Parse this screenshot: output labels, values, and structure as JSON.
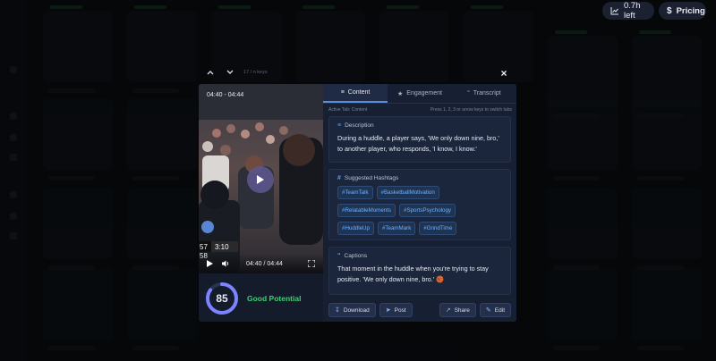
{
  "top_bar": {
    "credits_label": "0.7h left",
    "pricing_label": "Pricing"
  },
  "modal": {
    "nav_counter": "17 / n keys",
    "close_label": "×",
    "video": {
      "timestamp_top": "04:40 - 04:44",
      "time_display": "04:40 / 04:44",
      "scoreboard": [
        "57",
        "3:10",
        "58"
      ]
    },
    "score": {
      "value": "85",
      "value_fraction": 0.85,
      "label": "Good Potential",
      "ring_color": "#7c83ff",
      "label_color": "#3bd16f"
    },
    "tabs": [
      {
        "label": "Content",
        "icon": "document-lines-icon",
        "active": true
      },
      {
        "label": "Engagement",
        "icon": "star-icon",
        "active": false
      },
      {
        "label": "Transcript",
        "icon": "quote-icon",
        "active": false
      }
    ],
    "active_tab_label": "Active Tab: Content",
    "keys_hint": "Press 1, 2, 3 or arrow keys to switch tabs",
    "description": {
      "title": "Description",
      "text": "During a huddle, a player says, 'We only down nine, bro,' to another player, who responds, 'I know, I know.'"
    },
    "hashtags": {
      "title": "Suggested Hashtags",
      "items": [
        "#TeamTalk",
        "#BasketballMotivation",
        "#RelatableMoments",
        "#SportsPsychology",
        "#HuddleUp",
        "#TeamMark",
        "#GrindTime"
      ]
    },
    "captions": {
      "title": "Captions",
      "text": "That moment in the huddle when you're trying to stay positive. 'We only down nine, bro.' 🏀"
    },
    "actions": {
      "download": "Download",
      "post": "Post",
      "share": "Share",
      "edit": "Edit"
    }
  },
  "colors": {
    "accent": "#5a8ce0",
    "tag_text": "#6fb2ff",
    "panel_bg": "#172033"
  }
}
